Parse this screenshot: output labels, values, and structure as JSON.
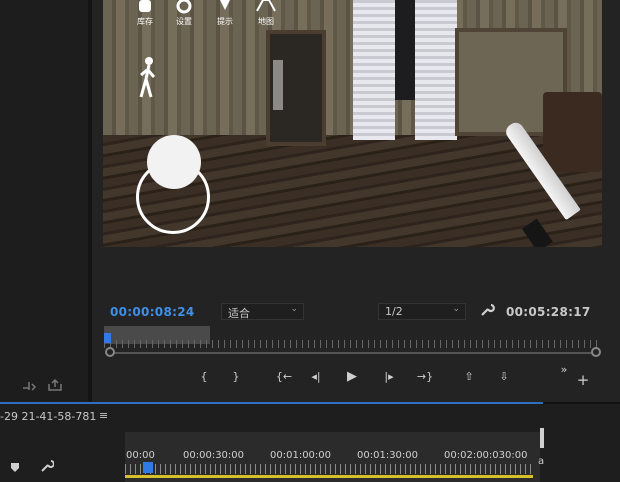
{
  "game_hud": {
    "items": [
      {
        "label": "库存",
        "icon": "backpack-icon"
      },
      {
        "label": "设置",
        "icon": "gear-icon"
      },
      {
        "label": "提示",
        "icon": "bulb-icon"
      },
      {
        "label": "地图",
        "icon": "map-icon"
      }
    ]
  },
  "program_monitor": {
    "current_timecode": "00:00:08:24",
    "zoom_select": "适合",
    "resolution_select": "1/2",
    "duration_timecode": "00:05:28:17",
    "transport": {
      "mark_in": "{",
      "mark_out": "}",
      "go_to_in": "{←",
      "step_back": "◂|",
      "play": "▶",
      "step_forward": "|▸",
      "go_to_out": "→}",
      "lift": "⇧",
      "extract": "⇩",
      "more": "»",
      "add": "+"
    }
  },
  "timeline": {
    "sequence_title": "-29 21-41-58-781",
    "menu_icon": "≡",
    "time_labels": [
      "00:00",
      "00:00:30:00",
      "00:01:00:00",
      "00:01:30:00",
      "00:02:00:030:00"
    ],
    "edge_label": "a"
  },
  "colors": {
    "accent_blue": "#3f8fe8",
    "playhead_blue": "#2f7ae5",
    "work_area_yellow": "#d6c12a"
  }
}
